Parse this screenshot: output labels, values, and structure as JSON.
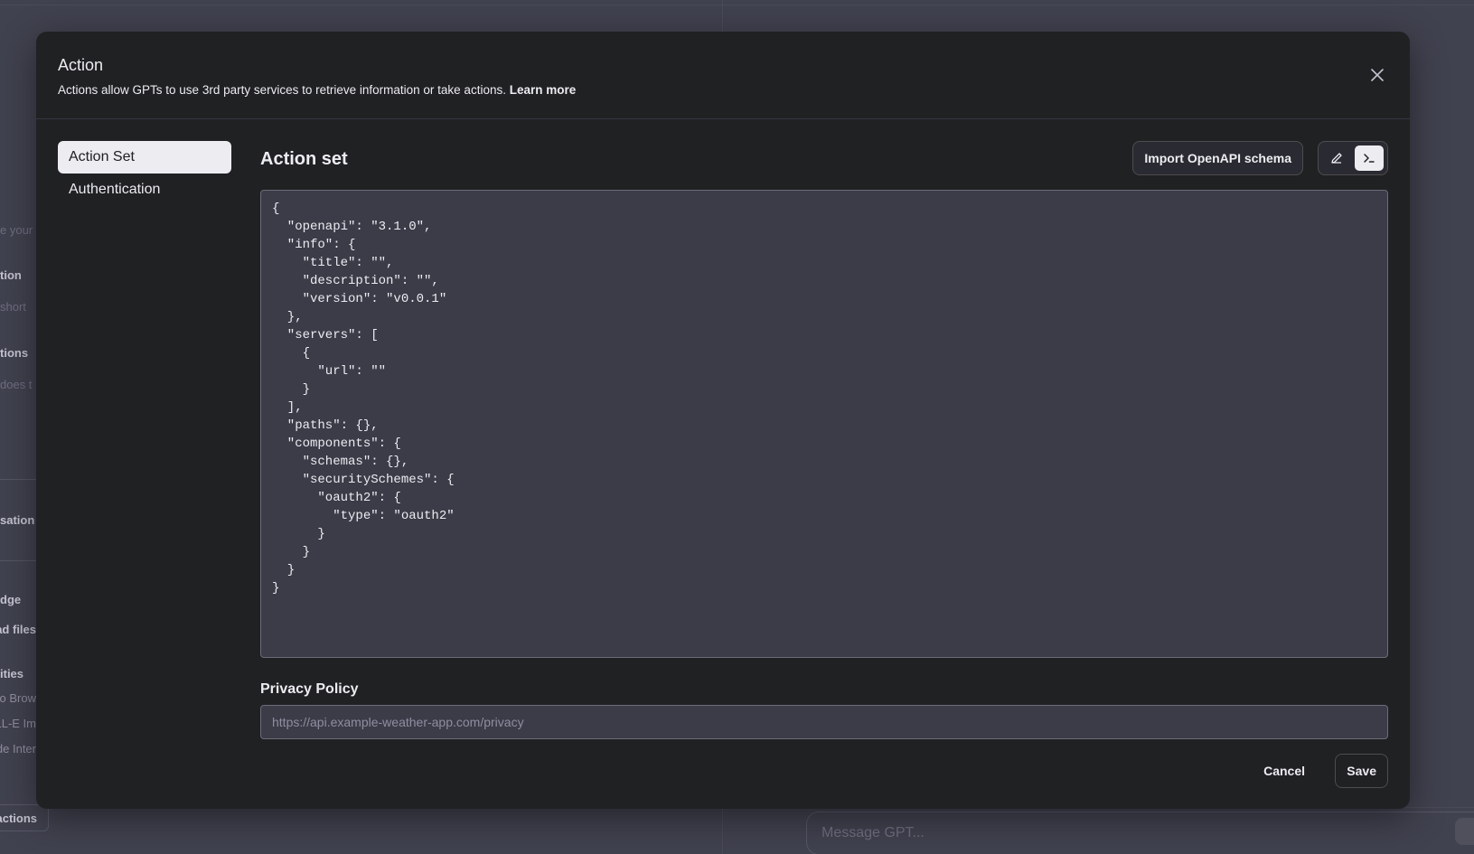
{
  "background": {
    "left_fragments": [
      {
        "text": "e your",
        "kind": "faint"
      },
      {
        "text": "tion",
        "kind": "label"
      },
      {
        "text": "short",
        "kind": "faint"
      },
      {
        "text": "tions",
        "kind": "label"
      },
      {
        "text": "does t",
        "kind": "faint"
      },
      {
        "text": "sation",
        "kind": "label"
      },
      {
        "text": "dge",
        "kind": "label"
      },
      {
        "text": "ad files",
        "kind": "label"
      },
      {
        "text": "ities",
        "kind": "label"
      },
      {
        "text": "o Brow",
        "kind": "text"
      },
      {
        "text": "LL-E Im",
        "kind": "text"
      },
      {
        "text": "de Inter",
        "kind": "text"
      }
    ],
    "actions_button": "actions",
    "message_placeholder": "Message GPT..."
  },
  "modal": {
    "title": "Action",
    "description": "Actions allow GPTs to use 3rd party services to retrieve information or take actions.",
    "learn_more": "Learn more",
    "close_icon": "close-icon"
  },
  "nav": {
    "items": [
      {
        "label": "Action Set",
        "active": true
      },
      {
        "label": "Authentication",
        "active": false
      }
    ]
  },
  "main": {
    "title": "Action set",
    "import_label": "Import OpenAPI schema",
    "mode_icons": [
      "pencil-icon",
      "terminal-icon"
    ],
    "active_mode": "terminal-icon",
    "schema": "{\n  \"openapi\": \"3.1.0\",\n  \"info\": {\n    \"title\": \"\",\n    \"description\": \"\",\n    \"version\": \"v0.0.1\"\n  },\n  \"servers\": [\n    {\n      \"url\": \"\"\n    }\n  ],\n  \"paths\": {},\n  \"components\": {\n    \"schemas\": {},\n    \"securitySchemes\": {\n      \"oauth2\": {\n        \"type\": \"oauth2\"\n      }\n    }\n  }\n}",
    "privacy_label": "Privacy Policy",
    "privacy_placeholder": "https://api.example-weather-app.com/privacy",
    "cancel_label": "Cancel",
    "save_label": "Save"
  }
}
